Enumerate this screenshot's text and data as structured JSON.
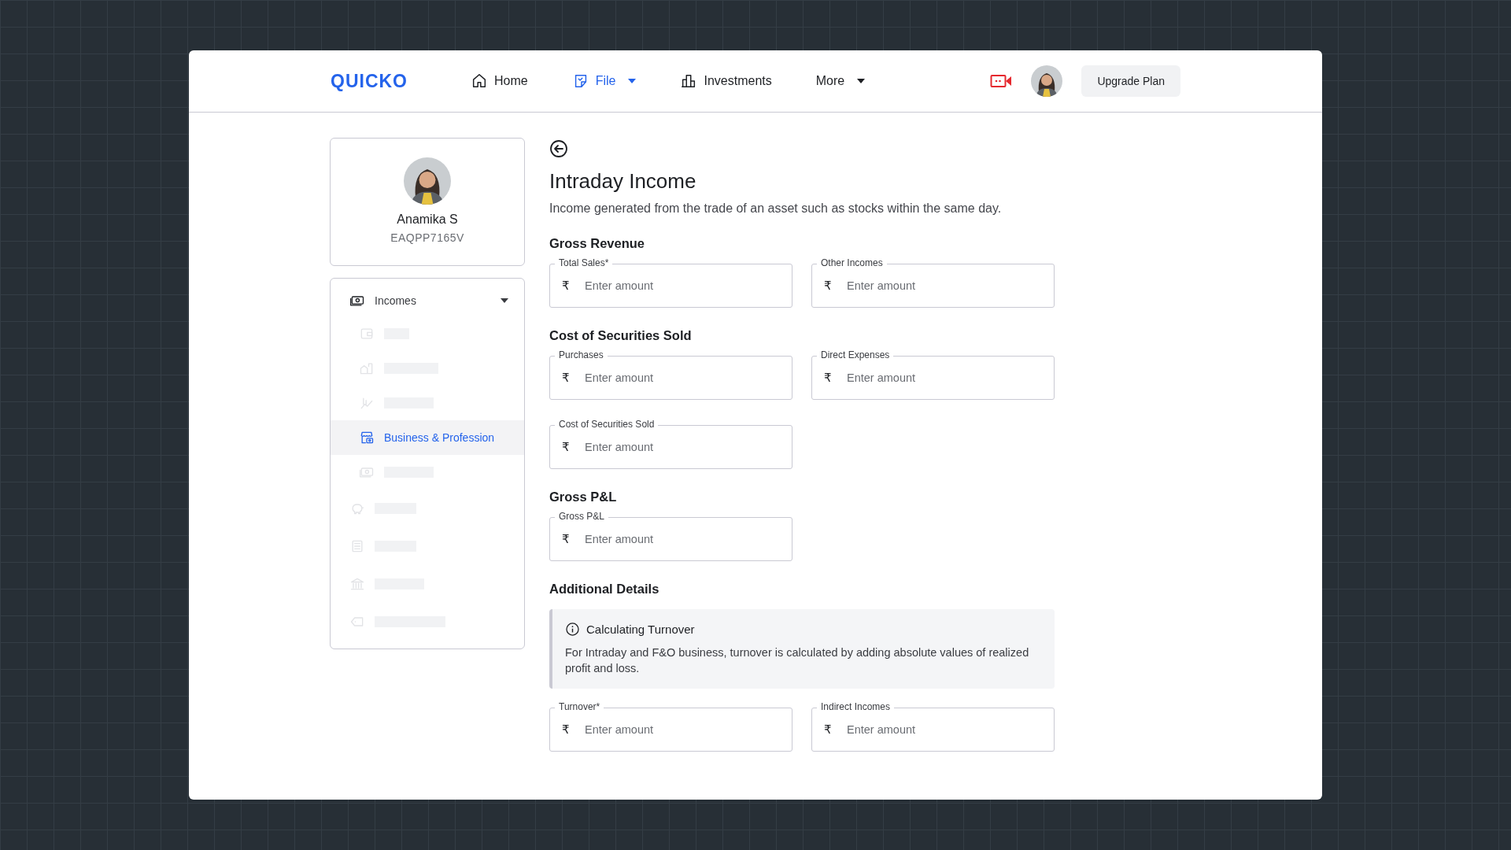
{
  "header": {
    "logo": "QUICKO",
    "nav": [
      {
        "label": "Home",
        "selected": false,
        "dropdown": false
      },
      {
        "label": "File",
        "selected": true,
        "dropdown": true
      },
      {
        "label": "Investments",
        "selected": false,
        "dropdown": false
      },
      {
        "label": "More",
        "selected": false,
        "dropdown": true
      }
    ],
    "upgrade_button": "Upgrade Plan"
  },
  "profile": {
    "name": "Anamika S",
    "pan": "EAQPP7165V"
  },
  "sidebar": {
    "items": [
      {
        "label": "Incomes",
        "kind": "item",
        "selected": false,
        "expanded": true,
        "children": [
          {
            "kind": "placeholder"
          },
          {
            "kind": "placeholder"
          },
          {
            "kind": "placeholder"
          },
          {
            "kind": "item",
            "label": "Business & Profession",
            "selected": true
          },
          {
            "kind": "placeholder"
          }
        ]
      },
      {
        "kind": "placeholder"
      },
      {
        "kind": "placeholder"
      },
      {
        "kind": "placeholder"
      },
      {
        "kind": "placeholder"
      }
    ]
  },
  "page": {
    "title": "Intraday Income",
    "description": "Income generated from the trade of an asset such as stocks within the same day.",
    "sections": [
      {
        "heading": "Gross Revenue",
        "fields": [
          {
            "label": "Total Sales*",
            "currency": "₹",
            "placeholder": "Enter amount"
          },
          {
            "label": "Other Incomes",
            "currency": "₹",
            "placeholder": "Enter amount"
          }
        ]
      },
      {
        "heading": "Cost of Securities Sold",
        "fields": [
          {
            "label": "Purchases",
            "currency": "₹",
            "placeholder": "Enter amount"
          },
          {
            "label": "Direct Expenses",
            "currency": "₹",
            "placeholder": "Enter amount"
          },
          {
            "label": "Cost of Securities Sold",
            "currency": "₹",
            "placeholder": "Enter amount"
          }
        ]
      },
      {
        "heading": "Gross P&L",
        "fields": [
          {
            "label": "Gross P&L",
            "currency": "₹",
            "placeholder": "Enter amount"
          }
        ]
      },
      {
        "heading": "Additional Details",
        "note": {
          "title": "Calculating Turnover",
          "text": "For Intraday and F&O business, turnover is calculated by adding absolute values of realized profit and loss."
        },
        "fields": [
          {
            "label": "Turnover*",
            "currency": "₹",
            "placeholder": "Enter amount"
          },
          {
            "label": "Indirect Incomes",
            "currency": "₹",
            "placeholder": "Enter amount"
          }
        ]
      }
    ]
  }
}
